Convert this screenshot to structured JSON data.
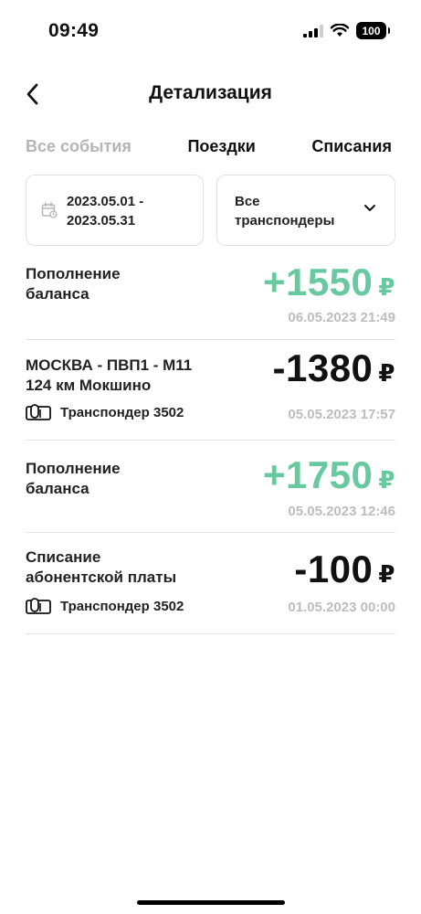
{
  "status_bar": {
    "time": "09:49",
    "battery": "100"
  },
  "header": {
    "title": "Детализация"
  },
  "tabs": [
    {
      "label": "Все события",
      "active": false
    },
    {
      "label": "Поездки",
      "active": true
    },
    {
      "label": "Списания",
      "active": true
    }
  ],
  "filters": {
    "date_from": "2023.05.01 -",
    "date_to": "2023.05.31",
    "transponder_line1": "Все",
    "transponder_line2": "транспондеры"
  },
  "transactions": [
    {
      "title_line1": "Пополнение",
      "title_line2": "баланса",
      "amount": "+1550",
      "currency": "₽",
      "date": "06.05.2023 21:49",
      "transponder": ""
    },
    {
      "title_line1": "МОСКВА - ПВП1 - М11",
      "title_line2": "124 км Мокшино",
      "amount": "-1380",
      "currency": "₽",
      "date": "05.05.2023 17:57",
      "transponder": "Транспондер 3502"
    },
    {
      "title_line1": "Пополнение",
      "title_line2": "баланса",
      "amount": "+1750",
      "currency": "₽",
      "date": "05.05.2023 12:46",
      "transponder": ""
    },
    {
      "title_line1": "Списание",
      "title_line2": "абонентской платы",
      "amount": "-100",
      "currency": "₽",
      "date": "01.05.2023 00:00",
      "transponder": "Транспондер 3502"
    }
  ],
  "colors": {
    "positive": "#68c8a0",
    "negative": "#111111",
    "muted": "#bdbdbd"
  },
  "icons": {
    "back": "chevron-left-icon",
    "calendar": "calendar-icon",
    "dropdown": "chevron-down-icon",
    "transponder": "transponder-device-icon"
  }
}
